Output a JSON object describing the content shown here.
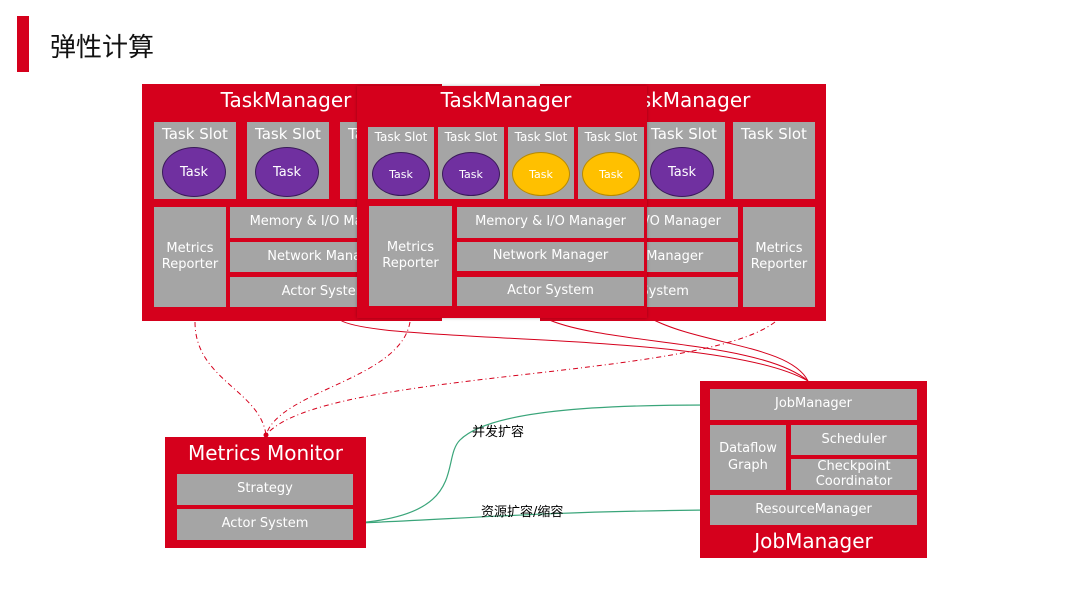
{
  "header": {
    "title": "弹性计算",
    "accent": "#d5001c"
  },
  "task_manager": {
    "title": "TaskManager",
    "slot": "Task Slot",
    "task": "Task",
    "metrics_reporter": "Metrics Reporter",
    "memory": "Memory & I/O Manager",
    "network": "Network Manager",
    "actor": "Actor System"
  },
  "metrics_monitor": {
    "title": "Metrics Monitor",
    "strategy": "Strategy",
    "actor": "Actor System"
  },
  "job_manager": {
    "title": "JobManager",
    "inner": "JobManager",
    "dataflow": "Dataflow Graph",
    "scheduler": "Scheduler",
    "checkpoint": "Checkpoint Coordinator",
    "resource": "ResourceManager"
  },
  "edges": {
    "parallel_scale": "并发扩容",
    "resource_scale": "资源扩容/缩容"
  },
  "colors": {
    "red": "#d5001c",
    "gray": "#a5a5a5",
    "purple": "#7030a0",
    "yellow": "#ffc000",
    "green": "#3aa57a"
  }
}
